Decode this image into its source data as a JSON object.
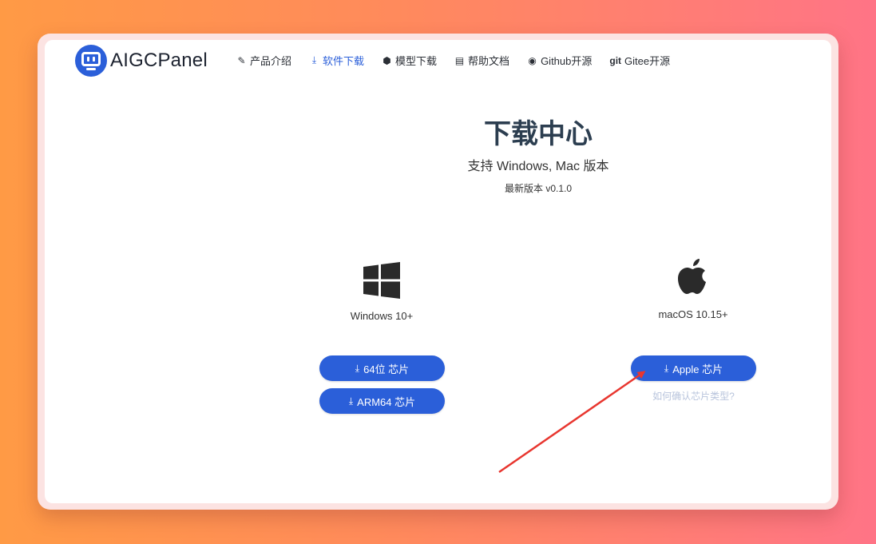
{
  "brand": {
    "name": "AIGCPanel"
  },
  "nav": [
    {
      "label": "产品介绍",
      "icon": "magic-wand-icon",
      "glyph": "✎",
      "active": false
    },
    {
      "label": "软件下载",
      "icon": "download-icon",
      "glyph": "⤓",
      "active": true
    },
    {
      "label": "模型下载",
      "icon": "cube-icon",
      "glyph": "⬢",
      "active": false
    },
    {
      "label": "帮助文档",
      "icon": "book-icon",
      "glyph": "▤",
      "active": false
    },
    {
      "label": "Github开源",
      "icon": "github-icon",
      "glyph": "◉",
      "active": false
    },
    {
      "label": "Gitee开源",
      "icon": "git-icon",
      "glyph": "git",
      "active": false
    }
  ],
  "hero": {
    "title": "下载中心",
    "subtitle": "支持 Windows, Mac 版本",
    "version": "最新版本 v0.1.0"
  },
  "windows": {
    "label": "Windows 10+",
    "btn_64": "64位 芯片",
    "btn_arm": "ARM64 芯片"
  },
  "mac": {
    "label": "macOS 10.15+",
    "btn_apple": "Apple 芯片",
    "help_link": "如何确认芯片类型?"
  },
  "colors": {
    "accent": "#2b5fd9",
    "annotation_arrow": "#e8362f"
  }
}
